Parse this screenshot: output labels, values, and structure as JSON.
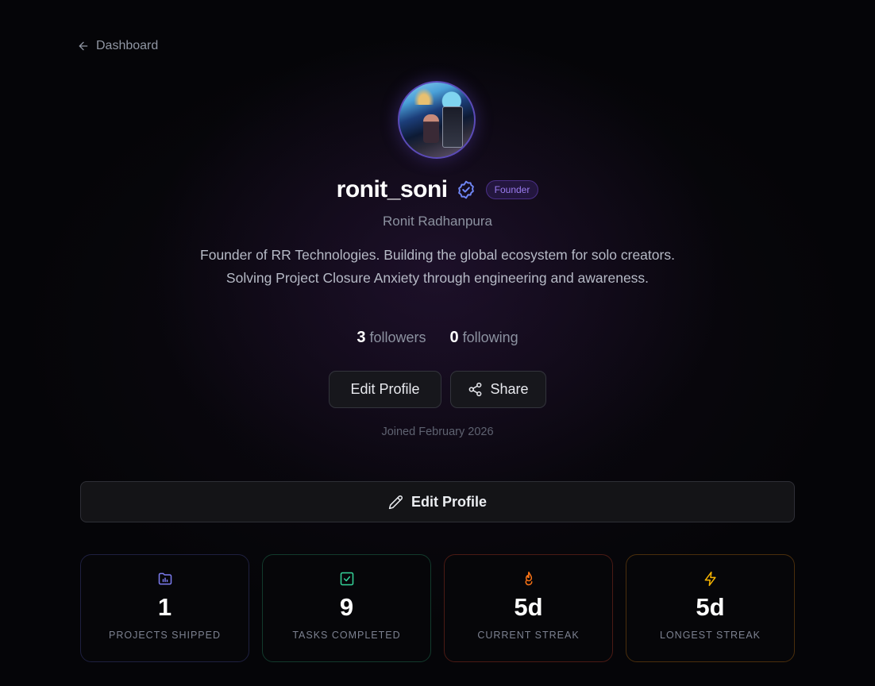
{
  "nav": {
    "back_label": "Dashboard"
  },
  "profile": {
    "username": "ronit_soni",
    "badge": "Founder",
    "full_name": "Ronit Radhanpura",
    "bio": "Founder of RR Technologies. Building the global ecosystem for solo creators. Solving Project Closure Anxiety through engineering and awareness.",
    "followers_count": "3",
    "followers_label": "followers",
    "following_count": "0",
    "following_label": "following",
    "joined": "Joined February 2026"
  },
  "actions": {
    "edit_label": "Edit Profile",
    "share_label": "Share",
    "edit_wide_label": "Edit Profile"
  },
  "cards": [
    {
      "icon": "folder-chart-icon",
      "value": "1",
      "label": "PROJECTS SHIPPED",
      "color": "#7c7cf0"
    },
    {
      "icon": "check-square-icon",
      "value": "9",
      "label": "TASKS COMPLETED",
      "color": "#34d399"
    },
    {
      "icon": "flame-icon",
      "value": "5d",
      "label": "CURRENT STREAK",
      "color": "#f97316"
    },
    {
      "icon": "zap-icon",
      "value": "5d",
      "label": "LONGEST STREAK",
      "color": "#f5b301"
    }
  ]
}
